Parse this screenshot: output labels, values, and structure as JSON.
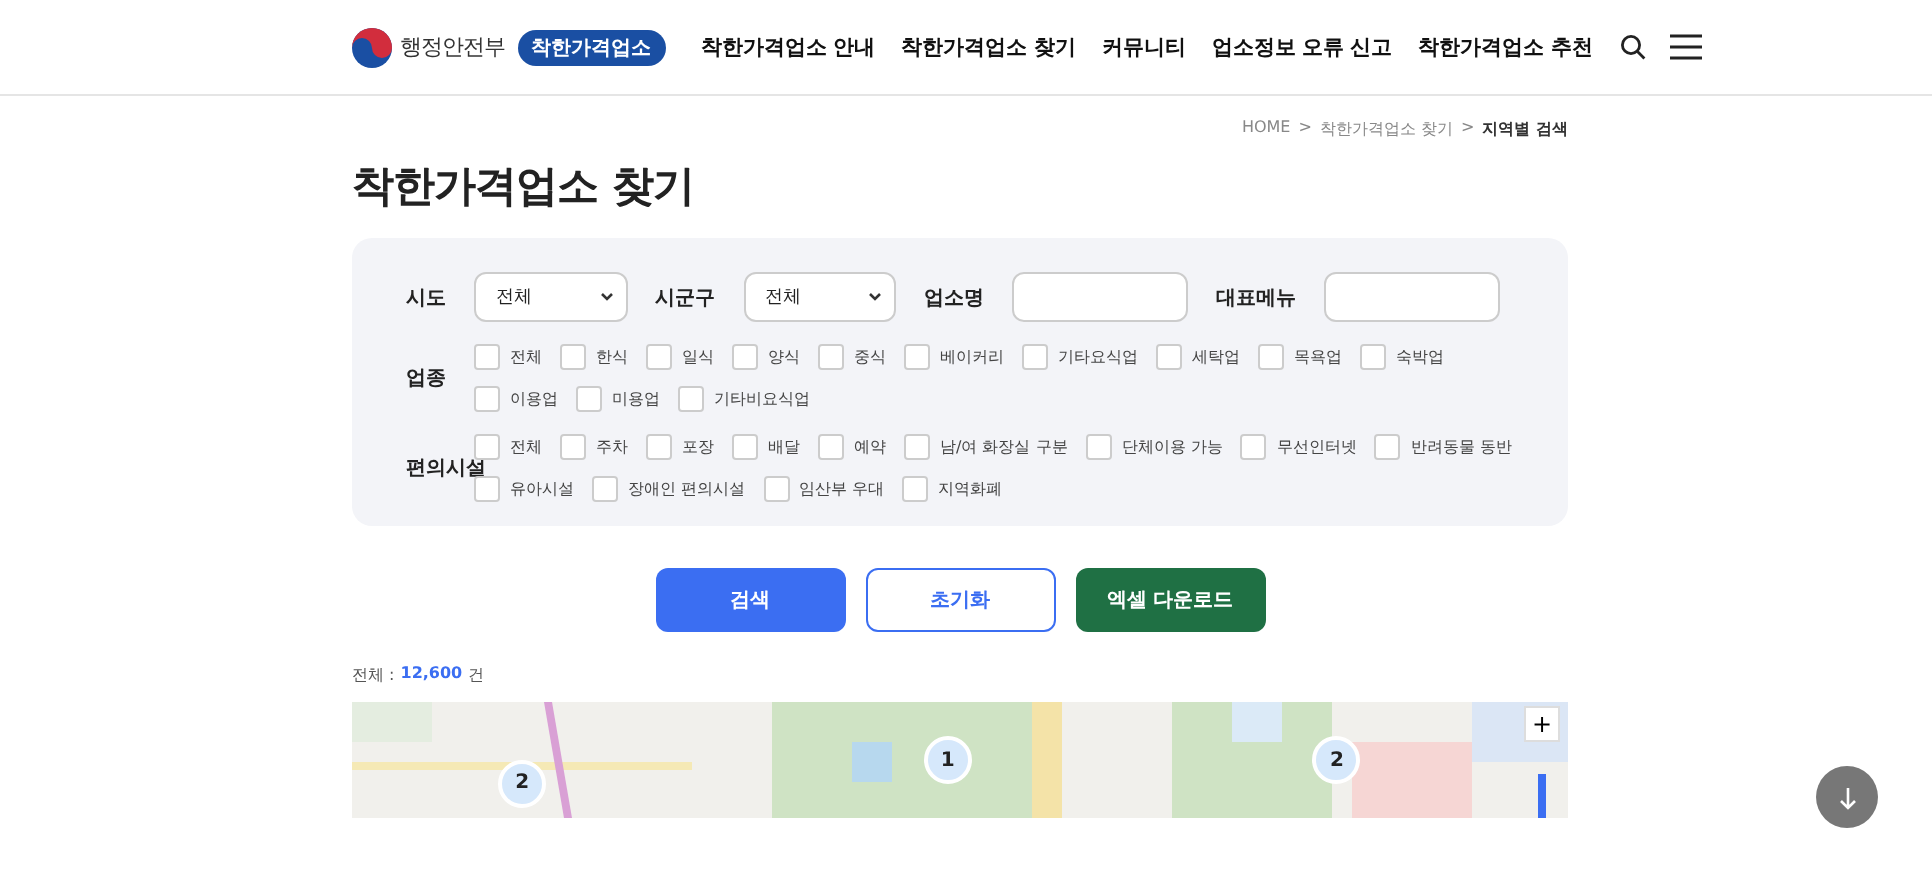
{
  "header": {
    "ministry": "행정안전부",
    "brand": "착한가격업소",
    "nav": [
      "착한가격업소 안내",
      "착한가격업소 찾기",
      "커뮤니티",
      "업소정보 오류 신고",
      "착한가격업소 추천"
    ]
  },
  "breadcrumb": [
    "HOME",
    "착한가격업소 찾기",
    "지역별 검색"
  ],
  "breadcrumb_separators": [
    ">",
    ">"
  ],
  "page_title": "착한가격업소 찾기",
  "filters": {
    "fields": [
      {
        "label": "시도",
        "kind": "select",
        "value": "전체"
      },
      {
        "label": "시군구",
        "kind": "select",
        "value": "전체"
      },
      {
        "label": "업소명",
        "kind": "input"
      },
      {
        "label": "대표메뉴",
        "kind": "input"
      }
    ],
    "groups": [
      {
        "label": "업종",
        "options": [
          {
            "label": "전체",
            "checked": false
          },
          {
            "label": "한식",
            "checked": false
          },
          {
            "label": "일식",
            "checked": false
          },
          {
            "label": "양식",
            "checked": false
          },
          {
            "label": "중식",
            "checked": false
          },
          {
            "label": "베이커리",
            "checked": false
          },
          {
            "label": "기타요식업",
            "checked": false
          },
          {
            "label": "세탁업",
            "checked": false
          },
          {
            "label": "목욕업",
            "checked": false
          },
          {
            "label": "숙박업",
            "checked": false
          },
          {
            "label": "이용업",
            "checked": false
          },
          {
            "label": "미용업",
            "checked": false
          },
          {
            "label": "기타비요식업",
            "checked": false
          }
        ]
      },
      {
        "label": "편의시설",
        "options": [
          {
            "label": "전체",
            "checked": false
          },
          {
            "label": "주차",
            "checked": false
          },
          {
            "label": "포장",
            "checked": false
          },
          {
            "label": "배달",
            "checked": false
          },
          {
            "label": "예약",
            "checked": false
          },
          {
            "label": "남/여 화장실 구분",
            "checked": false
          },
          {
            "label": "단체이용 가능",
            "checked": false
          },
          {
            "label": "무선인터넷",
            "checked": false
          },
          {
            "label": "반려동물 동반",
            "checked": false
          },
          {
            "label": "유아시설",
            "checked": false
          },
          {
            "label": "장애인 편의시설",
            "checked": false
          },
          {
            "label": "임산부 우대",
            "checked": false
          },
          {
            "label": "지역화폐",
            "checked": false
          }
        ]
      }
    ]
  },
  "buttons": [
    {
      "label": "검색",
      "kind": "primary"
    },
    {
      "label": "초기화",
      "kind": "outline"
    },
    {
      "label": "엑셀 다운로드",
      "kind": "excel"
    }
  ],
  "result_count": {
    "label": "전체 :",
    "count": "12,600",
    "unit": "건"
  },
  "map": {
    "clusters": [
      {
        "count": "2"
      },
      {
        "count": "1"
      },
      {
        "count": "2"
      }
    ],
    "zoom_in": "+"
  }
}
